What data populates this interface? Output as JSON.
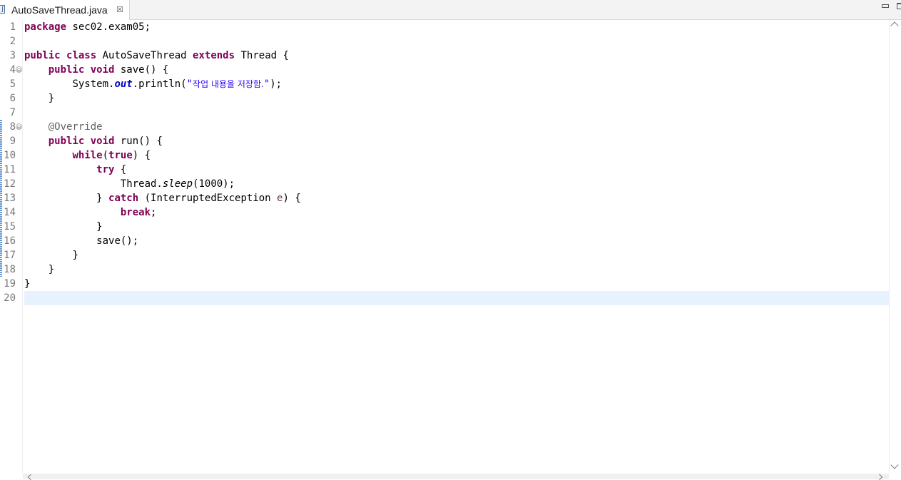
{
  "tab": {
    "title": "AutoSaveThread.java",
    "icon": "java-file-icon",
    "close_glyph": "☒"
  },
  "gutter": {
    "line_numbers": [
      "1",
      "2",
      "3",
      "4",
      "5",
      "6",
      "7",
      "8",
      "9",
      "10",
      "11",
      "12",
      "13",
      "14",
      "15",
      "16",
      "17",
      "18",
      "19",
      "20"
    ],
    "fold_glyph": "⊖"
  },
  "code": {
    "l1_kw": "package",
    "l1_rest": " sec02.exam05;",
    "l3_kw1": "public",
    "l3_kw2": "class",
    "l3_mid": " AutoSaveThread ",
    "l3_kw3": "extends",
    "l3_rest": " Thread {",
    "l4_kw1": "public",
    "l4_kw2": "void",
    "l4_rest": " save() {",
    "l5_pre": "System.",
    "l5_field": "out",
    "l5_call": ".println(",
    "l5_q1": "\"",
    "l5_str": "작업 내용을 저장함.",
    "l5_q2": "\"",
    "l5_end": ");",
    "l6": "}",
    "l8_ann": "@Override",
    "l9_kw1": "public",
    "l9_kw2": "void",
    "l9_rest": " run() {",
    "l10_kw1": "while",
    "l10_p1": "(",
    "l10_kw2": "true",
    "l10_rest": ") {",
    "l11_kw": "try",
    "l11_rest": " {",
    "l12_pre": "Thread.",
    "l12_meth": "sleep",
    "l12_rest": "(1000);",
    "l13_pre": "} ",
    "l13_kw": "catch",
    "l13_mid": " (InterruptedException ",
    "l13_var": "e",
    "l13_rest": ") {",
    "l14_kw": "break",
    "l14_rest": ";",
    "l15": "}",
    "l16": "save();",
    "l17": "}",
    "l18": "}",
    "l19": "}"
  },
  "colors": {
    "keyword": "#7f0055",
    "annotation": "#646464",
    "string": "#2a00ff",
    "static_field": "#0000c0",
    "current_line": "#e8f2fe"
  }
}
